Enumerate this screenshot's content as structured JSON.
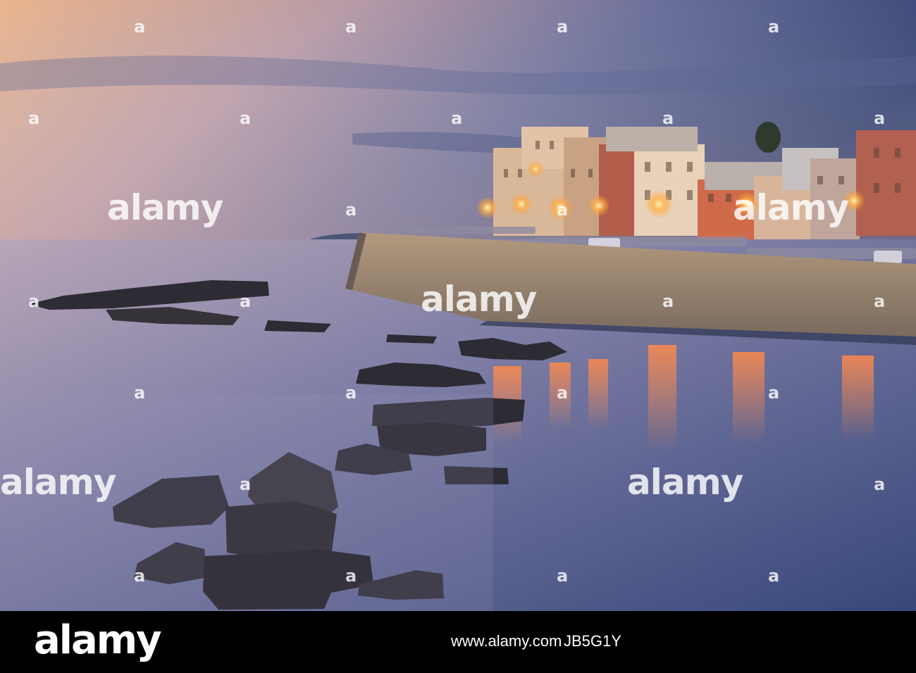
{
  "watermark": {
    "brand": "alamy",
    "small_mark": "a"
  },
  "footer": {
    "logo": "alamy",
    "site": "www.alamy.com",
    "image_id": "JB5G1Y"
  },
  "colors": {
    "sky_warm": "#e8b48a",
    "sky_cool": "#3a4a7a",
    "sea": "#3d4a7a",
    "lamp_glow": "#ffb347",
    "wall": "#a58a6e"
  }
}
